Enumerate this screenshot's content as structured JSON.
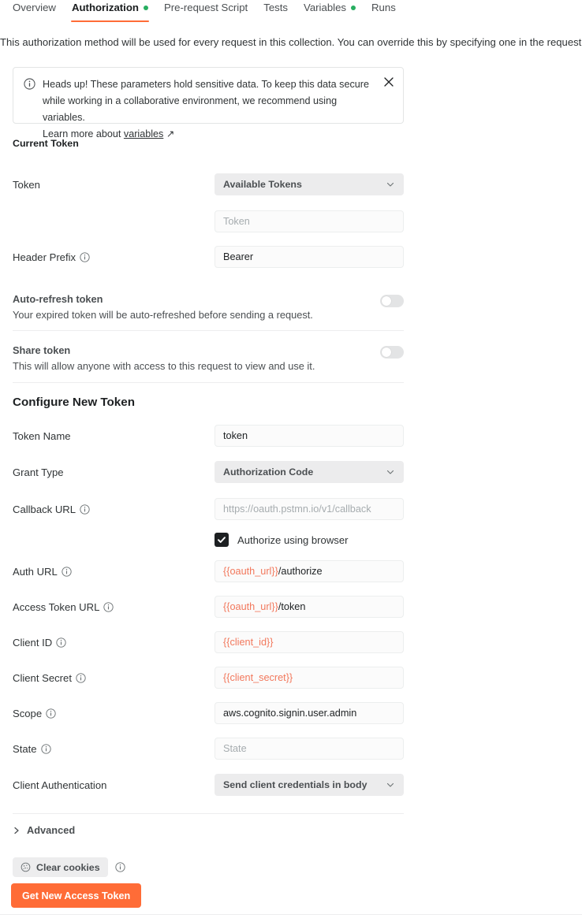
{
  "tabs": [
    {
      "label": "Overview",
      "active": false,
      "dot": false
    },
    {
      "label": "Authorization",
      "active": true,
      "dot": true
    },
    {
      "label": "Pre-request Script",
      "active": false,
      "dot": false
    },
    {
      "label": "Tests",
      "active": false,
      "dot": false
    },
    {
      "label": "Variables",
      "active": false,
      "dot": true
    },
    {
      "label": "Runs",
      "active": false,
      "dot": false
    }
  ],
  "description": "This authorization method will be used for every request in this collection. You can override this by specifying one in the request.",
  "callout": {
    "icon": "info-icon",
    "line1": "Heads up! These parameters hold sensitive data. To keep this data secure",
    "line2": "while working in a collaborative environment, we recommend using variables.",
    "line3_prefix": "Learn more about ",
    "link_text": "variables",
    "link_arrow": "↗",
    "close_icon": "close-icon"
  },
  "current_token": {
    "title": "Current Token",
    "token_label": "Token",
    "token_select_value": "Available Tokens",
    "token_input_placeholder": "Token",
    "header_prefix_label": "Header Prefix",
    "header_prefix_value": "Bearer",
    "auto_refresh": {
      "title": "Auto-refresh token",
      "subtitle": "Your expired token will be auto-refreshed before sending a request.",
      "state": "off"
    },
    "share_token": {
      "title": "Share token",
      "subtitle": "This will allow anyone with access to this request to view and use it.",
      "state": "off"
    }
  },
  "configure_new_token": {
    "title": "Configure New Token",
    "token_name_label": "Token Name",
    "token_name_value": "token",
    "grant_type_label": "Grant Type",
    "grant_type_value": "Authorization Code",
    "callback_url_label": "Callback URL",
    "callback_url_placeholder": "https://oauth.pstmn.io/v1/callback",
    "authorize_using_browser_label": "Authorize using browser",
    "authorize_using_browser_checked": true,
    "auth_url_label": "Auth URL",
    "auth_url_var": "{{oauth_url}}",
    "auth_url_rest": "/authorize",
    "access_token_url_label": "Access Token URL",
    "access_token_url_var": "{{oauth_url}}",
    "access_token_url_rest": "/token",
    "client_id_label": "Client ID",
    "client_id_value": "{{client_id}}",
    "client_secret_label": "Client Secret",
    "client_secret_value": "{{client_secret}}",
    "scope_label": "Scope",
    "scope_value": "aws.cognito.signin.user.admin",
    "state_label": "State",
    "state_placeholder": "State",
    "client_auth_label": "Client Authentication",
    "client_auth_value": "Send client credentials in body"
  },
  "advanced": {
    "label": "Advanced",
    "icon": "chevron-right-icon"
  },
  "actions": {
    "clear_cookies_label": "Clear cookies",
    "clear_cookies_icon": "cookie-icon",
    "clear_cookies_info_icon": "info-icon",
    "get_token_label": "Get New Access Token"
  },
  "colors": {
    "accent": "#ff6c37",
    "dot_green": "#27ae60",
    "variable": "#f2785c",
    "select_bg": "#ececed",
    "input_bg": "#fbfbfb"
  }
}
